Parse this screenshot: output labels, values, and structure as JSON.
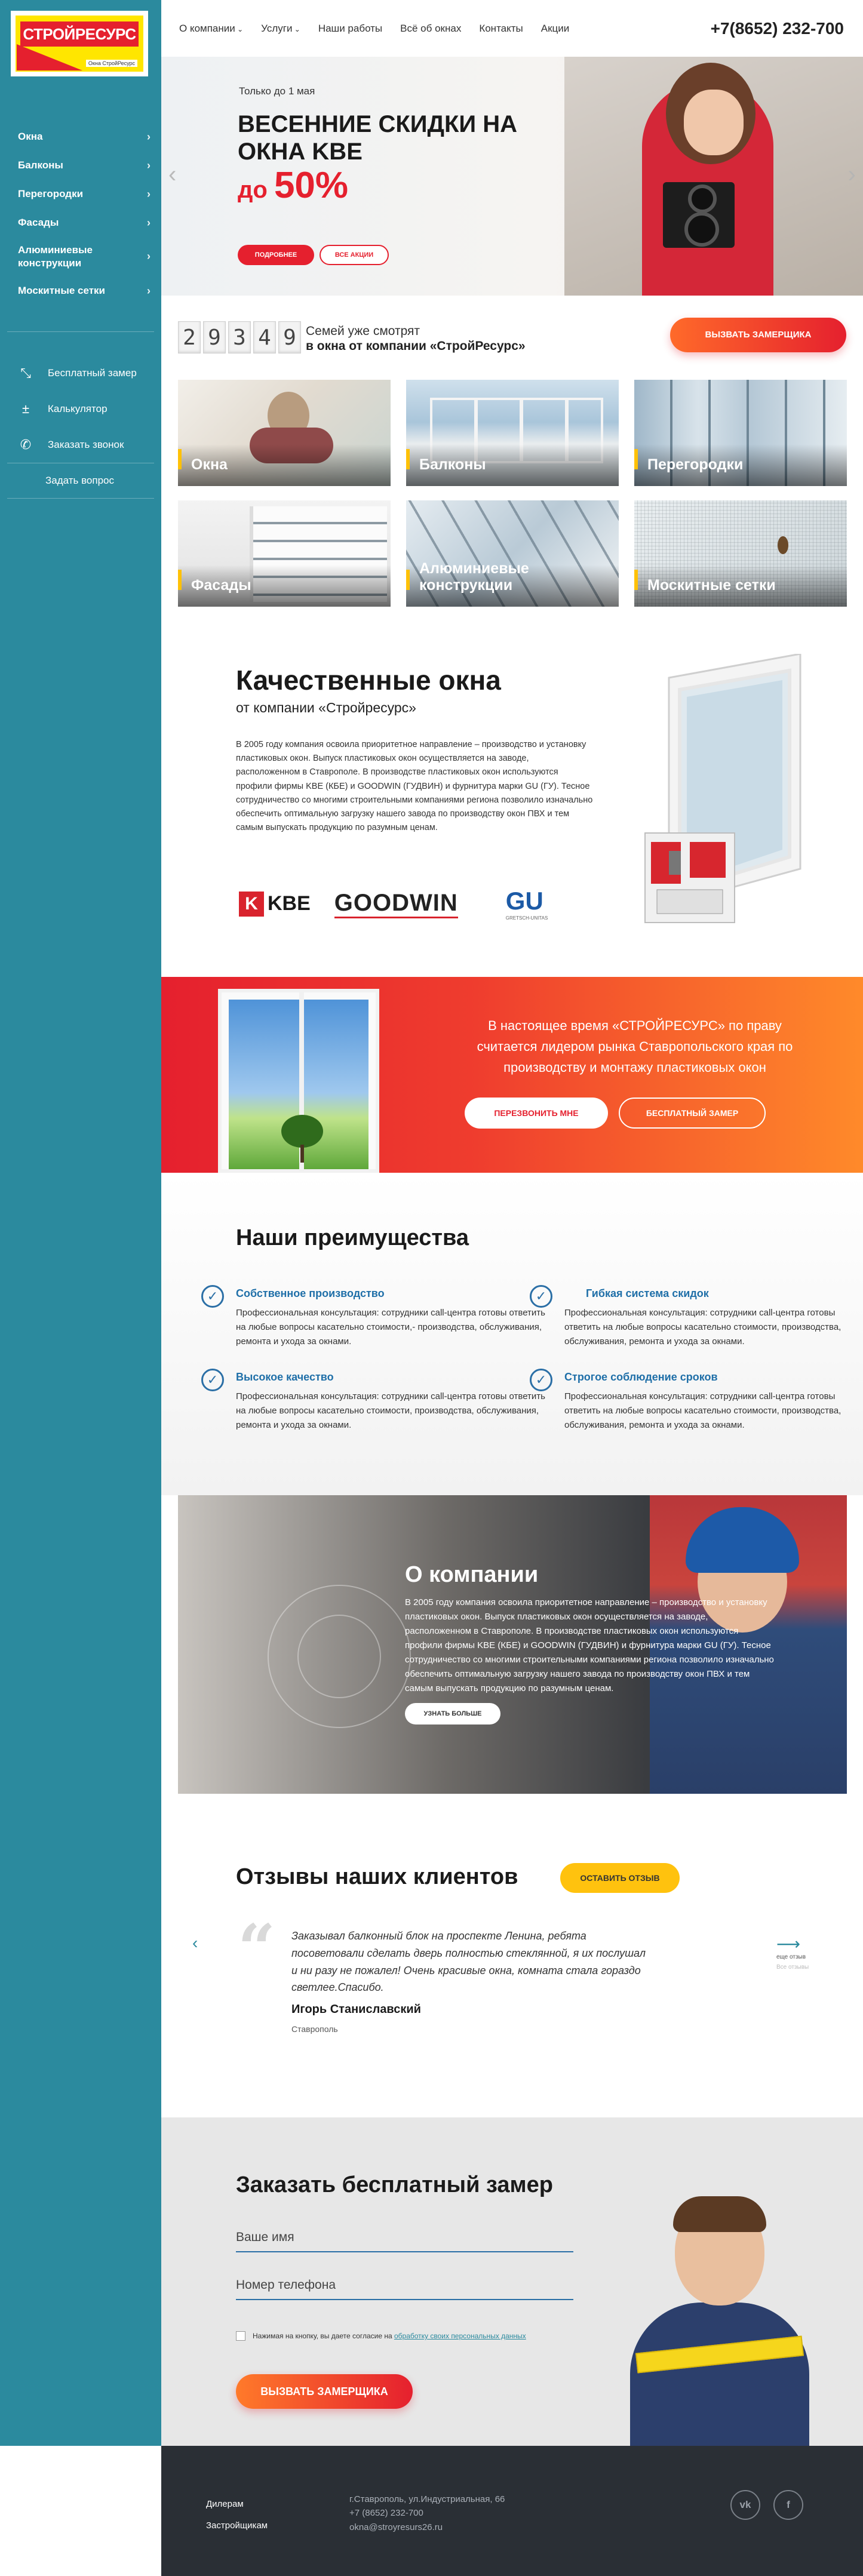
{
  "logo": {
    "text": "СТРОЙРЕСУРС",
    "sub": "Окна СтройРесурс"
  },
  "sidebar": {
    "items": [
      {
        "label": "Окна"
      },
      {
        "label": "Балконы"
      },
      {
        "label": "Перегородки"
      },
      {
        "label": "Фасады"
      },
      {
        "label": "Алюминиевые конструкции"
      },
      {
        "label": "Москитные сетки"
      }
    ],
    "actions": [
      {
        "label": "Бесплатный замер",
        "icon": "ruler-icon"
      },
      {
        "label": "Калькулятор",
        "icon": "calculator-icon"
      },
      {
        "label": "Заказать звонок",
        "icon": "phone-icon"
      }
    ],
    "ask": "Задать вопрос"
  },
  "nav": {
    "items": [
      {
        "label": "О компании",
        "dropdown": true
      },
      {
        "label": "Услуги",
        "dropdown": true
      },
      {
        "label": "Наши работы"
      },
      {
        "label": "Всё об окнах"
      },
      {
        "label": "Контакты"
      },
      {
        "label": "Акции"
      }
    ],
    "phone": "+7(8652) 232-700"
  },
  "hero": {
    "small": "Только до 1 мая",
    "title": "ВЕСЕННИЕ СКИДКИ НА ОКНА KBE",
    "sale_prefix": "до",
    "sale_value": "50%",
    "btn_more": "ПОДРОБНЕЕ",
    "btn_all": "ВСЕ АКЦИИ"
  },
  "counter": {
    "digits": [
      "2",
      "9",
      "3",
      "4",
      "9"
    ],
    "line1": "Семей уже смотрят",
    "line2": "в окна от компании «СтройРесурс»",
    "button": "ВЫЗВАТЬ ЗАМЕРЩИКА"
  },
  "tiles": [
    {
      "label": "Окна"
    },
    {
      "label": "Балконы"
    },
    {
      "label": "Перегородки"
    },
    {
      "label": "Фасады"
    },
    {
      "label": "Алюминиевые конструкции"
    },
    {
      "label": "Москитные сетки"
    }
  ],
  "quality": {
    "title": "Качественные окна",
    "subtitle": "от компании «Стройресурс»",
    "text": "В 2005 году компания освоила приоритетное направление – производство и установку пластиковых окон. Выпуск пластиковых окон осуществляется на заводе, расположенном в Ставрополе. В производстве пластиковых окон используются профили фирмы KBE (КБЕ) и GOODWIN (ГУДВИН) и фурнитура марки GU (ГУ). Тесное сотрудничество со многими строительными компаниями региона позволило изначально обеспечить оптимальную загрузку нашего завода по производству окон ПВХ и тем самым выпускать продукцию по разумным ценам.",
    "logos": {
      "kbe": "KBE",
      "goodwin": "GOODWIN",
      "gu": "GU",
      "gu_sub": "GRETSCH-UNITAS"
    }
  },
  "leader": {
    "text": "В настоящее время «СТРОЙРЕСУРС» по праву считается лидером рынка Ставропольского края по производству и монтажу пластиковых окон",
    "btn_call": "ПЕРЕЗВОНИТЬ МНЕ",
    "btn_measure": "БЕСПЛАТНЫЙ ЗАМЕР"
  },
  "advantages": {
    "title": "Наши преимущества",
    "items": [
      {
        "title": "Собственное производство",
        "text": "Профессиональная консультация: сотрудники call-центра готовы ответить на любые вопросы касательно стоимости,- производства, обслуживания, ремонта и ухода за окнами."
      },
      {
        "title": "Гибкая система скидок",
        "text": "Профессиональная консультация: сотрудники call-центра готовы ответить на любые вопросы касательно стоимости, производства, обслуживания, ремонта и ухода за окнами."
      },
      {
        "title": "Высокое качество",
        "text": "Профессиональная консультация: сотрудники call-центра готовы ответить на любые вопросы касательно стоимости, производства, обслуживания, ремонта и ухода за окнами."
      },
      {
        "title": "Строгое соблюдение сроков",
        "text": "Профессиональная консультация: сотрудники call-центра готовы ответить на любые вопросы касательно стоимости, производства, обслуживания, ремонта и ухода за окнами."
      }
    ]
  },
  "about": {
    "title": "О компании",
    "text": "В 2005 году компания освоила приоритетное направление – производство и установку пластиковых окон. Выпуск пластиковых окон осуществляется на заводе, расположенном в Ставрополе. В производстве пластиковых окон используются профили фирмы KBE (КБЕ) и GOODWIN (ГУДВИН) и фурнитура марки GU (ГУ). Тесное сотрудничество со многими строительными компаниями региона позволило изначально обеспечить оптимальную загрузку нашего завода по производству окон ПВХ и тем самым выпускать продукцию по разумным ценам.",
    "button": "УЗНАТЬ БОЛЬШЕ"
  },
  "reviews": {
    "title": "Отзывы наших клиентов",
    "button": "ОСТАВИТЬ ОТЗЫВ",
    "text": "Заказывал балконный блок на проспекте Ленина, ребята посоветовали сделать дверь полностью стеклянной, я их послушал и ни разу не пожалел! Очень красивые окна, комната стала гораздо светлее.Спасибо.",
    "name": "Игорь Станиславский",
    "city": "Ставрополь",
    "next_label": "еще отзыв",
    "next_sub": "Все отзывы"
  },
  "order": {
    "title": "Заказать бесплатный замер",
    "name_placeholder": "Ваше имя",
    "phone_placeholder": "Номер телефона",
    "consent": "Нажимая на кнопку, вы даете согласие на",
    "consent_link": "обработку своих персональных данных",
    "button": "ВЫЗВАТЬ ЗАМЕРЩИКА"
  },
  "footer": {
    "link1": "Дилерам",
    "link2": "Застройщикам",
    "address": "г.Ставрополь, ул.Индустриальная, 66",
    "phone": "+7 (8652) 232-700",
    "email": "okna@stroyresurs26.ru"
  },
  "colors": {
    "accent": "#e5202e",
    "sidebar": "#2b8a9e",
    "link": "#1f6fa8",
    "yellow": "#ffc20e"
  }
}
